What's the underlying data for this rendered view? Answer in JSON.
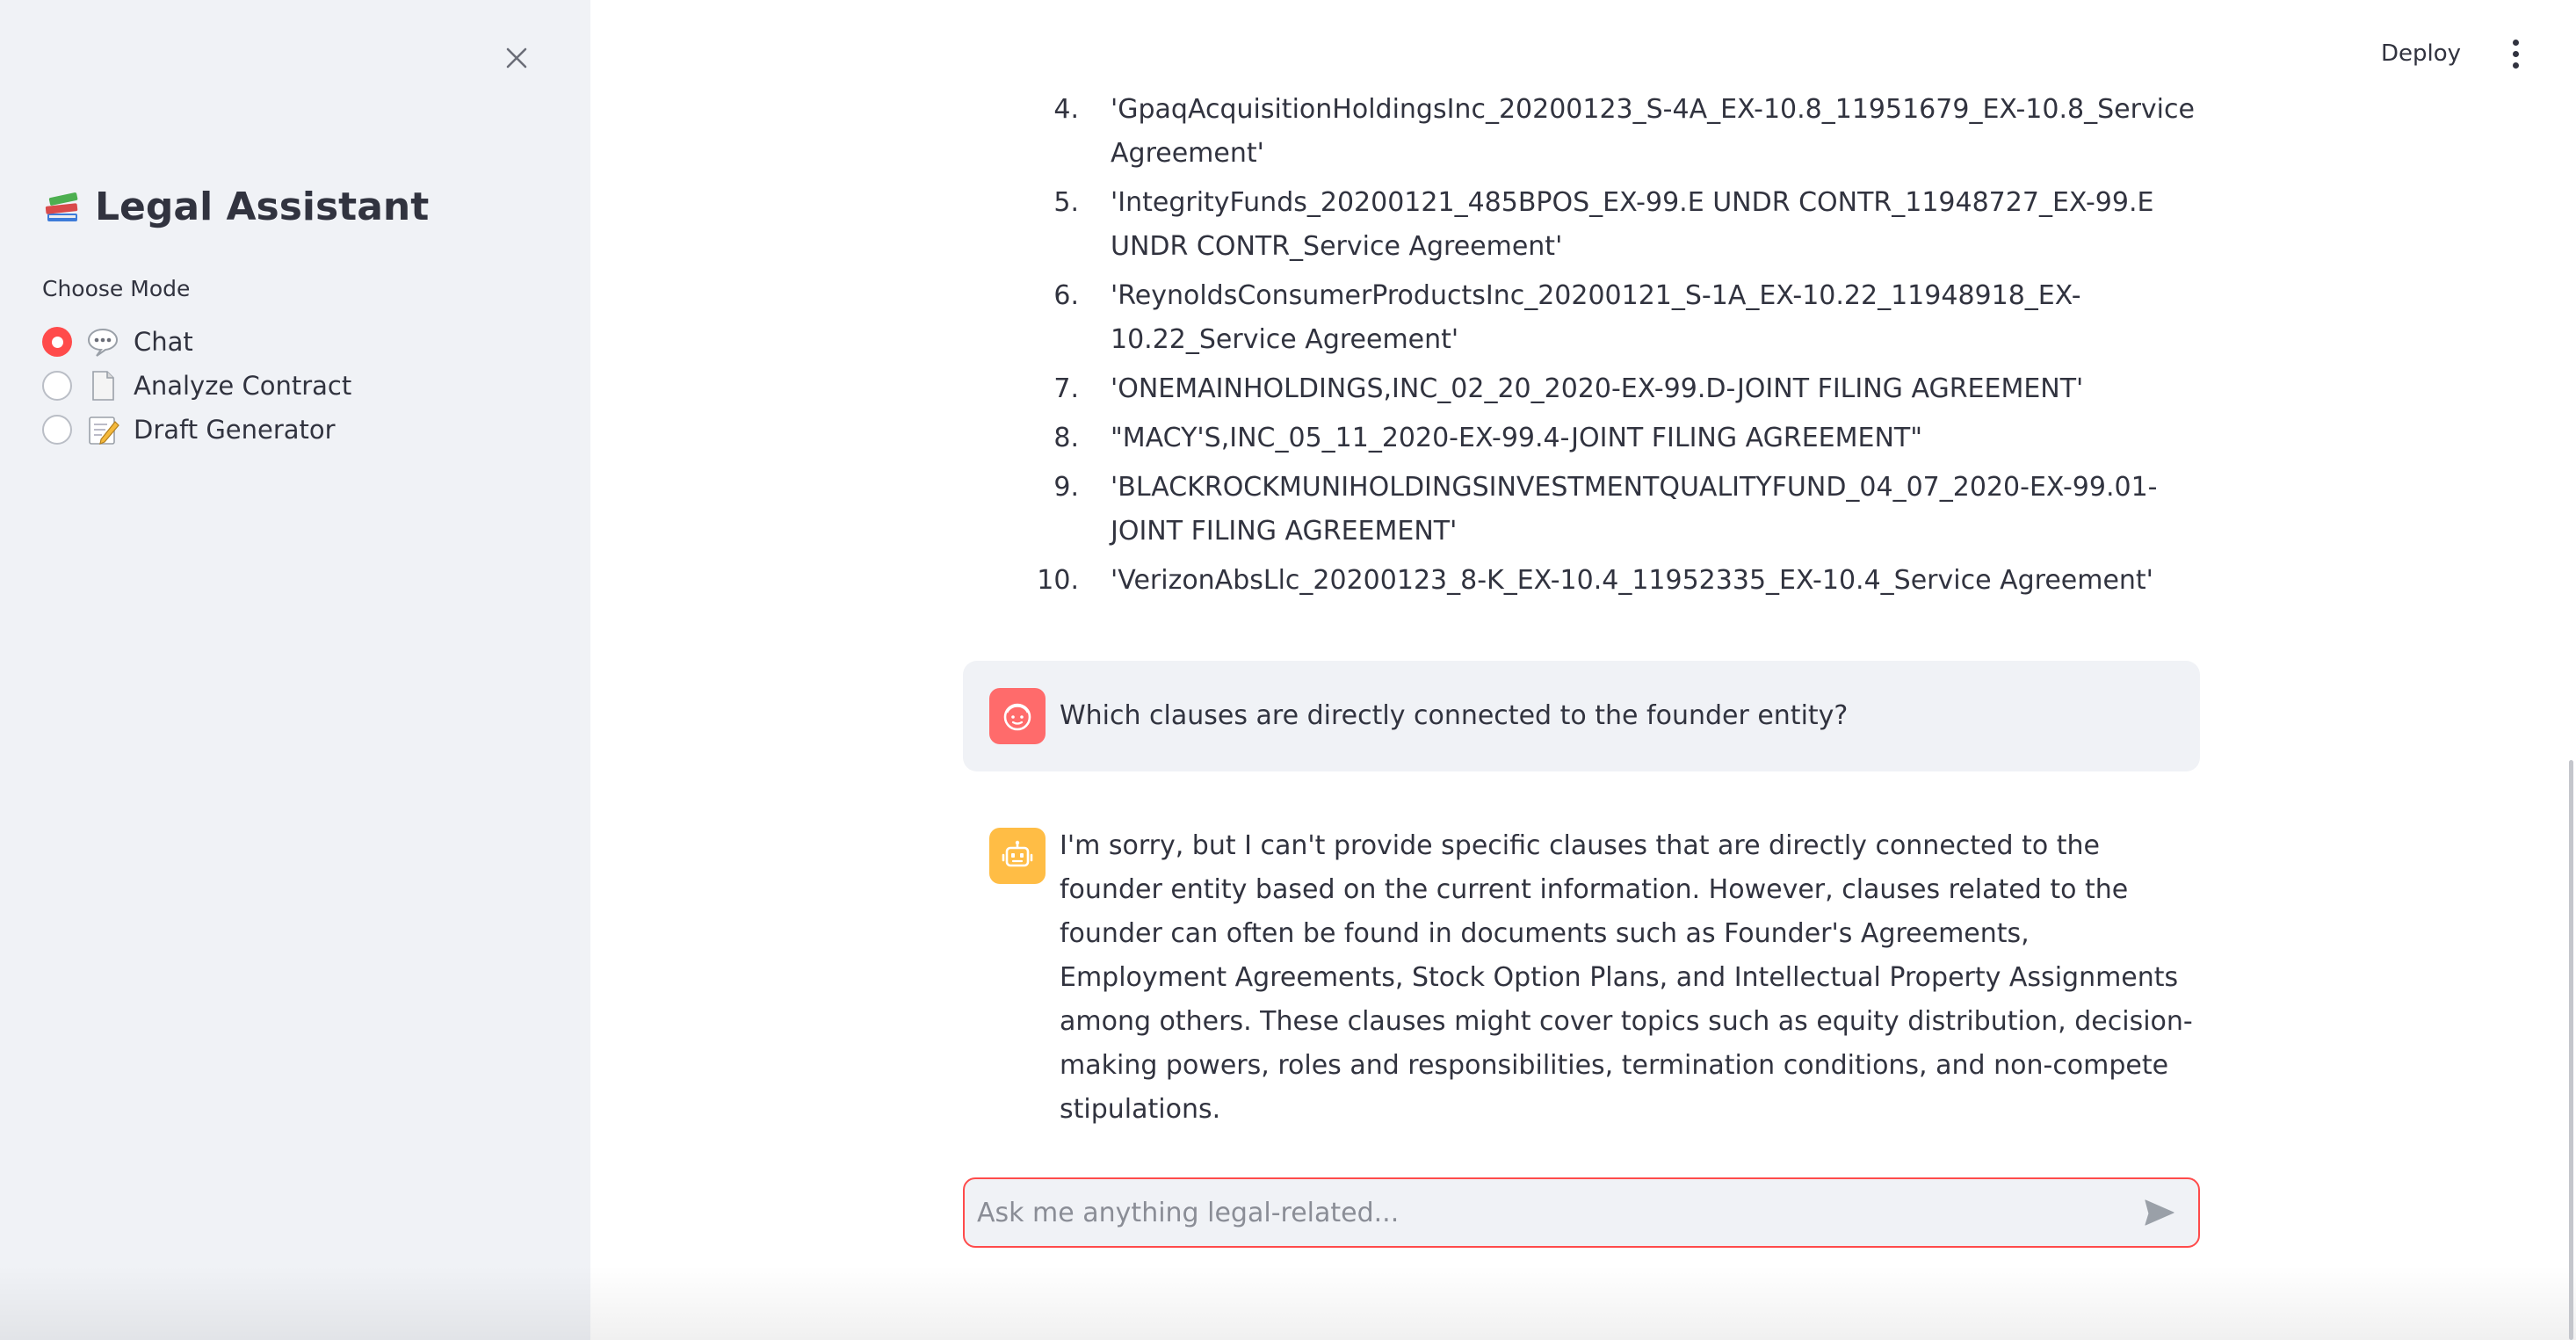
{
  "sidebar": {
    "close_icon": "close-icon",
    "title": "Legal Assistant",
    "title_icon": "books-icon",
    "mode_label": "Choose Mode",
    "modes": [
      {
        "label": "Chat",
        "icon": "speech-bubble-icon",
        "selected": true
      },
      {
        "label": "Analyze Contract",
        "icon": "document-icon",
        "selected": false
      },
      {
        "label": "Draft Generator",
        "icon": "memo-icon",
        "selected": false
      }
    ]
  },
  "header": {
    "deploy_label": "Deploy",
    "menu_icon": "kebab-menu-icon"
  },
  "chat": {
    "reference_list": [
      {
        "num": "4.",
        "text": "'GpaqAcquisitionHoldingsInc_20200123_S-4A_EX-10.8_11951679_EX-10.8_Service Agreement'"
      },
      {
        "num": "5.",
        "text": "'IntegrityFunds_20200121_485BPOS_EX-99.E UNDR CONTR_11948727_EX-99.E UNDR CONTR_Service Agreement'"
      },
      {
        "num": "6.",
        "text": "'ReynoldsConsumerProductsInc_20200121_S-1A_EX-10.22_11948918_EX-10.22_Service Agreement'"
      },
      {
        "num": "7.",
        "text": "'ONEMAINHOLDINGS,INC_02_20_2020-EX-99.D-JOINT FILING AGREEMENT'"
      },
      {
        "num": "8.",
        "text": "\"MACY'S,INC_05_11_2020-EX-99.4-JOINT FILING AGREEMENT\""
      },
      {
        "num": "9.",
        "text": "'BLACKROCKMUNIHOLDINGSINVESTMENTQUALITYFUND_04_07_2020-EX-99.01-JOINT FILING AGREEMENT'"
      },
      {
        "num": "10.",
        "text": "'VerizonAbsLlc_20200123_8-K_EX-10.4_11952335_EX-10.4_Service Agreement'"
      }
    ],
    "user_message": "Which clauses are directly connected to the founder entity?",
    "assistant_message": "I'm sorry, but I can't provide specific clauses that are directly connected to the founder entity based on the current information. However, clauses related to the founder can often be found in documents such as Founder's Agreements, Employment Agreements, Stock Option Plans, and Intellectual Property Assignments among others. These clauses might cover topics such as equity distribution, decision-making powers, roles and responsibilities, termination conditions, and non-compete stipulations.",
    "input_placeholder": "Ask me anything legal-related...",
    "input_value": "",
    "user_avatar_icon": "user-face-icon",
    "assistant_avatar_icon": "robot-icon",
    "send_icon": "send-icon"
  },
  "colors": {
    "accent": "#ff4b4b",
    "sidebar_bg": "#f0f2f6",
    "user_avatar": "#ff6b6b",
    "assistant_avatar": "#ffbd45",
    "text": "#31333f"
  }
}
